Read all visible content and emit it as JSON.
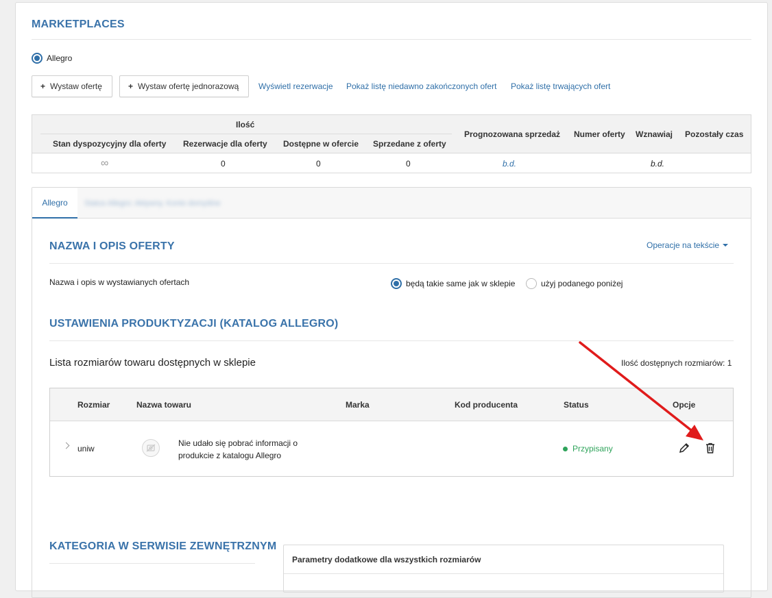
{
  "marketplaces": {
    "title": "MARKETPLACES",
    "radio_label": "Allegro",
    "buttons": {
      "list_offer": "Wystaw ofertę",
      "list_offer_once": "Wystaw ofertę jednorazową"
    },
    "links": {
      "reservations": "Wyświetl rezerwacje",
      "recently_ended": "Pokaż listę niedawno zakończonych ofert",
      "ongoing": "Pokaż listę trwających ofert"
    }
  },
  "quantity_table": {
    "group_header": "Ilość",
    "headers": {
      "available_stock": "Stan dyspozycyjny dla oferty",
      "reservations": "Rezerwacje dla oferty",
      "available_in_offer": "Dostępne w ofercie",
      "sold": "Sprzedane z oferty",
      "forecast": "Prognozowana sprzedaż",
      "offer_number": "Numer oferty",
      "renew": "Wznawiaj",
      "remaining_time": "Pozostały czas"
    },
    "row": {
      "available_stock": "∞",
      "reservations": "0",
      "available_in_offer": "0",
      "sold": "0",
      "forecast": "b.d.",
      "renew": "b.d."
    }
  },
  "tabs": {
    "active": "Allegro",
    "second": "Status Allegro: Aktywny. Konto domyślne"
  },
  "name_section": {
    "title": "NAZWA I OPIS OFERTY",
    "operations_link": "Operacje na tekście",
    "row_label": "Nazwa i opis w wystawianych ofertach",
    "option_same": "będą takie same jak w sklepie",
    "option_custom": "użyj podanego poniżej"
  },
  "productization": {
    "title": "USTAWIENIA PRODUKTYZACJI (KATALOG ALLEGRO)",
    "list_title": "Lista rozmiarów towaru dostępnych w sklepie",
    "sizes_count": "Ilość dostępnych rozmiarów: 1",
    "headers": {
      "size": "Rozmiar",
      "name": "Nazwa towaru",
      "brand": "Marka",
      "producer_code": "Kod producenta",
      "status": "Status",
      "options": "Opcje"
    },
    "row": {
      "size": "uniw",
      "name": "Nie udało się pobrać informacji o produkcie z katalogu Allegro",
      "status": "Przypisany",
      "status_color": "#2ea35a"
    }
  },
  "category": {
    "title": "KATEGORIA W SERWISIE ZEWNĘTRZNYM",
    "params_header": "Parametry dodatkowe dla wszystkich rozmiarów"
  },
  "colors": {
    "accent": "#2f6fa8",
    "annotation_arrow": "#e01b1b"
  }
}
